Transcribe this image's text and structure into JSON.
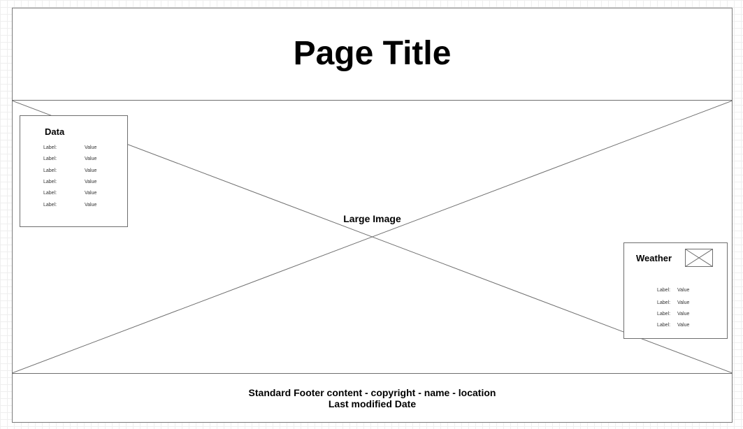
{
  "header": {
    "title": "Page Title"
  },
  "hero": {
    "label": "Large Image"
  },
  "data_panel": {
    "title": "Data",
    "rows": [
      {
        "label": "Label:",
        "value": "Value"
      },
      {
        "label": "Label:",
        "value": "Value"
      },
      {
        "label": "Label:",
        "value": "Value"
      },
      {
        "label": "Label:",
        "value": "Value"
      },
      {
        "label": "Label:",
        "value": "Value"
      },
      {
        "label": "Label:",
        "value": "Value"
      }
    ]
  },
  "weather_panel": {
    "title": "Weather",
    "icon": "image-placeholder-icon",
    "rows": [
      {
        "label": "Label:",
        "value": "Value"
      },
      {
        "label": "Label:",
        "value": "Value"
      },
      {
        "label": "Label:",
        "value": "Value"
      },
      {
        "label": "Label:",
        "value": "Value"
      }
    ]
  },
  "footer": {
    "line1": "Standard Footer content - copyright - name - location",
    "line2": "Last modified Date"
  },
  "colors": {
    "border": "#6e6e6e",
    "grid": "#efefef",
    "text": "#000000"
  }
}
